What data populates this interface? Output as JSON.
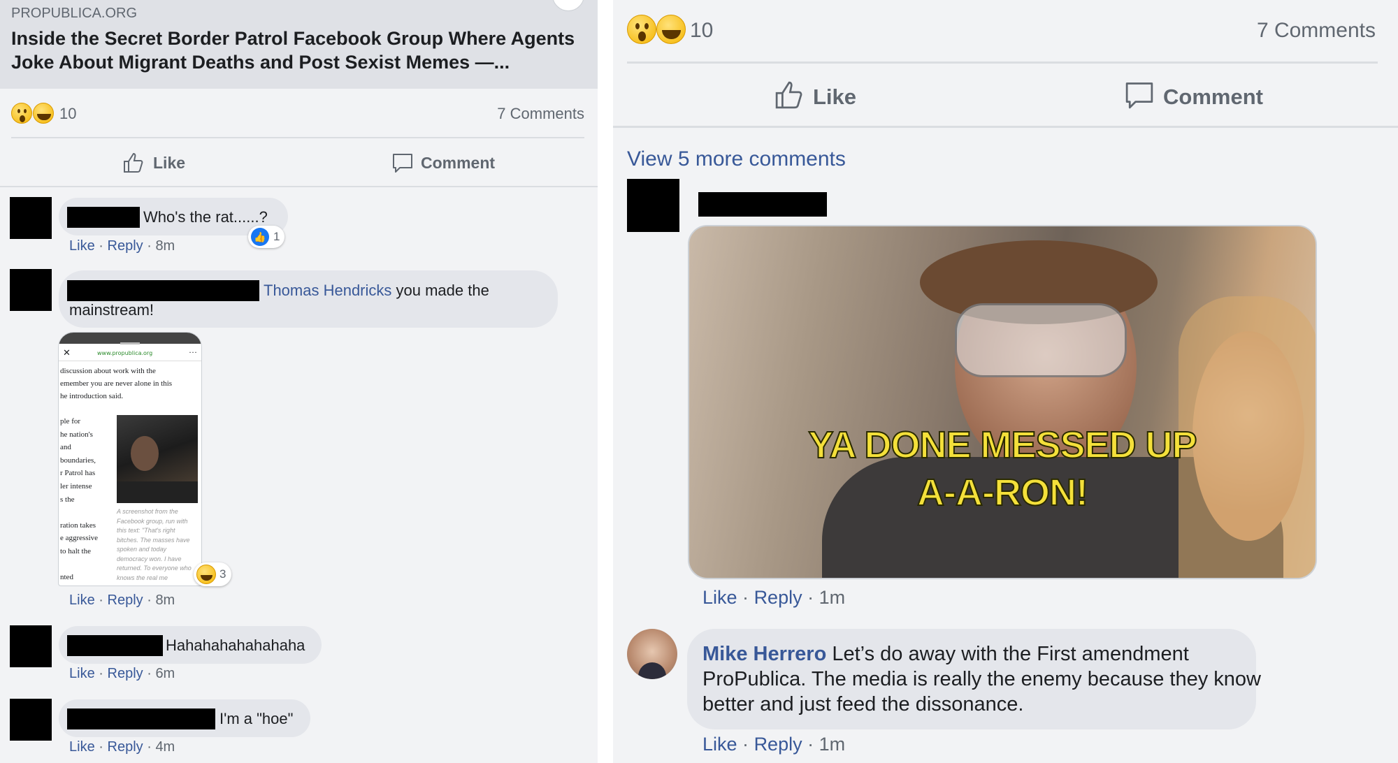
{
  "left": {
    "link_preview": {
      "domain": "PROPUBLICA.ORG",
      "title_line1": "Inside the Secret Border Patrol Facebook Group Where Agents",
      "title_line2": "Joke About Migrant Deaths and Post Sexist Memes —..."
    },
    "reactions": {
      "count": "10",
      "comments": "7 Comments",
      "icons": [
        "wow-emoji",
        "laugh-emoji"
      ]
    },
    "actions": {
      "like": "Like",
      "comment": "Comment"
    },
    "comments": [
      {
        "text": "Who's the rat......?",
        "like": "Like",
        "reply": "Reply",
        "time": "8m",
        "reaction_count": "1"
      },
      {
        "mention": "Thomas Hendricks",
        "text": " you made the",
        "text2": "mainstream!",
        "like": "Like",
        "reply": "Reply",
        "time": "8m",
        "reaction_count": "3",
        "screenshot": {
          "url": "www.propublica.org",
          "lines": [
            "discussion about work with the",
            "emember you are never alone in this",
            "he introduction said."
          ],
          "col_lines": [
            "ple for",
            "he nation's",
            "and",
            "boundaries,",
            "r Patrol has",
            "ler intense",
            "s the",
            "",
            "ration takes",
            "e aggressive",
            "to halt the",
            "",
            "nted"
          ],
          "caption": "A screenshot from the Facebook group, run with this text: \"That's right bitches. The masses have spoken and today democracy won. I have returned. To everyone who knows the real me"
        }
      },
      {
        "text": "Hahahahahahahaha",
        "like": "Like",
        "reply": "Reply",
        "time": "6m"
      },
      {
        "text": "I'm a \"hoe\"",
        "like": "Like",
        "reply": "Reply",
        "time": "4m"
      }
    ],
    "sep": "·"
  },
  "right": {
    "reactions": {
      "count": "10",
      "comments": "7 Comments"
    },
    "actions": {
      "like": "Like",
      "comment": "Comment"
    },
    "view_more": "View 5 more comments",
    "gif_comment": {
      "caption_line1": "YA DONE MESSED UP",
      "caption_line2": "A-A-RON!",
      "like": "Like",
      "reply": "Reply",
      "time": "1m"
    },
    "mike_comment": {
      "name": "Mike Herrero",
      "line1": " Let’s do away with the First amendment",
      "line2": "ProPublica. The media is really the enemy because they know",
      "line3": "better and just feed the dissonance.",
      "like": "Like",
      "reply": "Reply",
      "time": "1m"
    },
    "sep": "·"
  },
  "colors": {
    "link": "#385898",
    "meta": "#606770",
    "panel_bg": "#f2f3f5",
    "bubble": "#e4e6eb",
    "like_blue": "#1877f2"
  }
}
